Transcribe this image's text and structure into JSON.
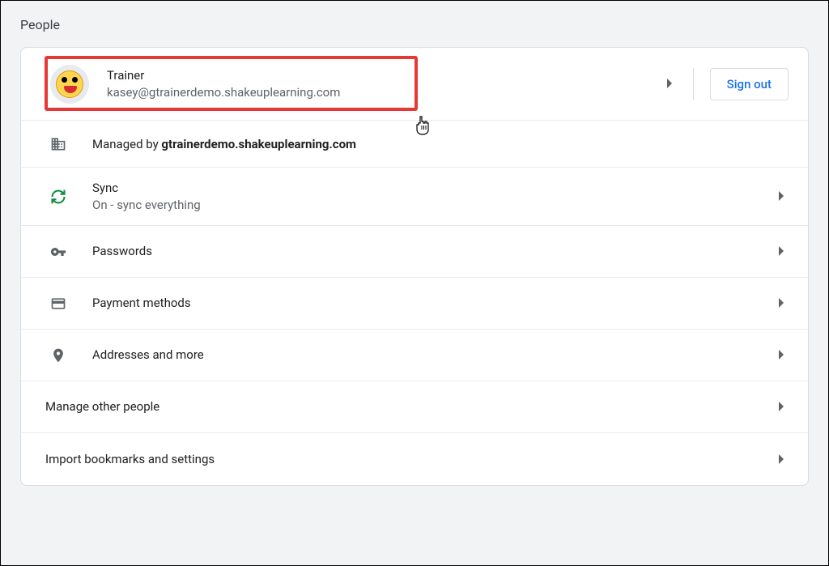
{
  "section": {
    "title": "People"
  },
  "profile": {
    "name": "Trainer",
    "email": "kasey@gtrainerdemo.shakeuplearning.com",
    "signout_label": "Sign out"
  },
  "managed": {
    "prefix": "Managed by ",
    "domain": "gtrainerdemo.shakeuplearning.com"
  },
  "sync": {
    "title": "Sync",
    "status": "On - sync everything"
  },
  "passwords": {
    "title": "Passwords"
  },
  "payment": {
    "title": "Payment methods"
  },
  "addresses": {
    "title": "Addresses and more"
  },
  "manage_people": {
    "title": "Manage other people"
  },
  "import": {
    "title": "Import bookmarks and settings"
  }
}
